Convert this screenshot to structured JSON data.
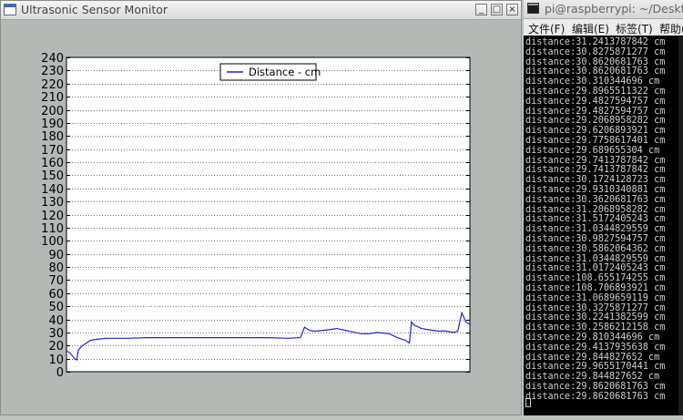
{
  "left_window": {
    "title": "Ultrasonic Sensor Monitor",
    "buttons": {
      "minimize": "_",
      "maximize": "□",
      "close": "×"
    }
  },
  "chart_data": {
    "type": "line",
    "title": "",
    "xlabel": "",
    "ylabel": "",
    "xlim": [
      0,
      100
    ],
    "ylim": [
      0,
      240
    ],
    "yticks": [
      0,
      10,
      20,
      30,
      40,
      50,
      60,
      70,
      80,
      90,
      100,
      110,
      120,
      130,
      140,
      150,
      160,
      170,
      180,
      190,
      200,
      210,
      220,
      230,
      240
    ],
    "grid": true,
    "legend_position": "top-center",
    "series": [
      {
        "name": "Distance - cm",
        "color": "#2222cc",
        "x": [
          0,
          1,
          2,
          2.5,
          3,
          4,
          5,
          6,
          8,
          10,
          12,
          15,
          20,
          25,
          30,
          35,
          40,
          45,
          50,
          55,
          58,
          59,
          60,
          61,
          62,
          65,
          67,
          70,
          73,
          75,
          77,
          80,
          82,
          84,
          85,
          85.5,
          86,
          88,
          90,
          92,
          94,
          96,
          97,
          98,
          99,
          100
        ],
        "y": [
          16,
          14,
          10,
          9,
          17,
          20,
          22,
          24,
          25,
          25.5,
          25.5,
          25.5,
          26,
          26,
          26,
          26,
          26,
          26,
          26,
          25.5,
          26,
          34,
          32,
          31,
          31,
          32,
          33,
          31,
          29,
          29,
          30,
          29,
          26,
          24,
          22,
          38,
          36,
          33,
          32,
          31,
          31,
          30,
          31,
          45,
          38,
          36
        ]
      }
    ]
  },
  "right_window": {
    "title": "pi@raspberrypi: ~/Desktop",
    "menu": [
      "文件(F)",
      "编辑(E)",
      "标签(T)",
      "帮助(H)"
    ],
    "lines": [
      "distance:31.2413787842 cm",
      "distance:30.8275871277 cm",
      "distance:30.8620681763 cm",
      "distance:30.8620681763 cm",
      "distance:30.310344696 cm",
      "distance:29.8965511322 cm",
      "distance:29.4827594757 cm",
      "distance:29.4827594757 cm",
      "distance:29.2068958282 cm",
      "distance:29.6206893921 cm",
      "distance:29.7758617401 cm",
      "distance:29.689655304 cm",
      "distance:29.7413787842 cm",
      "distance:29.7413787842 cm",
      "distance:30.1724128723 cm",
      "distance:29.9310340881 cm",
      "distance:30.3620681763 cm",
      "distance:31.2068958282 cm",
      "distance:31.5172405243 cm",
      "distance:31.0344829559 cm",
      "distance:30.9827594757 cm",
      "distance:30.5862064362 cm",
      "distance:31.0344829559 cm",
      "distance:31.0172405243 cm",
      "distance:108.655174255 cm",
      "distance:108.706893921 cm",
      "distance:31.0689659119 cm",
      "distance:30.3275871277 cm",
      "distance:30.2241382599 cm",
      "distance:30.2586212158 cm",
      "distance:29.810344696 cm",
      "distance:29.4137935638 cm",
      "distance:29.844827652 cm",
      "distance:29.9655170441 cm",
      "distance:29.844827652 cm",
      "distance:29.8620681763 cm",
      "distance:29.8620681763 cm"
    ]
  }
}
